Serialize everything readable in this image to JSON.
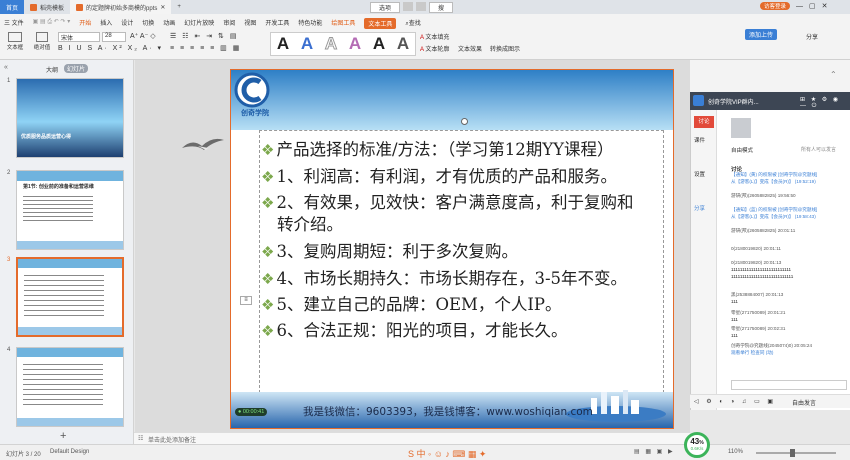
{
  "titlebar": {
    "tabs": [
      "首页",
      "稻壳模板",
      "的定题牌初始多商模的ppts"
    ],
    "center_btns": [
      "选项",
      "搜"
    ],
    "window": [
      "访客登录",
      "分享",
      "0"
    ],
    "cloud": "添加上传"
  },
  "menu": {
    "file": "三 文件",
    "items": [
      "开始",
      "插入",
      "设计",
      "切换",
      "动画",
      "幻灯片放映",
      "审阅",
      "视图",
      "开发工具",
      "特色功能"
    ],
    "drawing_tools": "绘图工具",
    "text_tools": "文本工具",
    "search": "查找"
  },
  "ribbon": {
    "font_name": "宋体",
    "font_size": "28",
    "textbox": "文本框",
    "style_label": "绝对值",
    "wordart_label": "A",
    "text_fill": "文本填充",
    "text_outline": "文本轮廓",
    "text_effect": "文本效果",
    "convert": "转换成图示"
  },
  "leftpane": {
    "tab_outline": "大纲",
    "tab_slides": "幻灯片",
    "slide_nums": [
      "1",
      "2",
      "3",
      "4"
    ],
    "slide1_title": "优质服务品质运营心得",
    "slide2_title": "第1节: 创业前的准备和运营思维",
    "add": "+"
  },
  "slide": {
    "logo_text": "创奇学院",
    "bullets": [
      "产品选择的标准/方法：（学习第12期YY课程）",
      "1、利润高：有利润，才有优质的产品和服务。",
      "2、有效果，见效快：客户满意度高，利于复购和",
      "转介绍。",
      "3、复购周期短：利于多次复购。",
      "4、市场长期持久：市场长期存在，3-5年不变。",
      "5、建立自己的品牌：OEM，个人IP。",
      "6、合法正规：阳光的项目，才能长久。"
    ],
    "footer": "我是钱微信：9603393，我是钱博客：www.woshiqian.com",
    "timer": "00:00:41"
  },
  "rpanel": {
    "title": "创奇学院VIP群内...",
    "side_tabs": [
      "讨论",
      "课件",
      "设置",
      "分享"
    ],
    "mode": "自由模式",
    "everyone": "所有人可以发言",
    "section": "讨论",
    "msgs": [
      "【通知】(黄) 的权限被 [创奇学院@究题线]",
      "从【游客(L)】变成【会员(R)】 (19:52:19)",
      "游研(邦)(2605882825) 19:56:50",
      "【通知】(蓝) 的权限被 [创奇学院@究题线]",
      "从【游客(L)】变成【会员(R)】 (19:58:43)",
      "游研(邦)(2605882825) 20:01:11",
      "0(2180019820) 20:01:11",
      "0(2180019820) 20:01:13",
      "111111111111111111111111111",
      "1111111111111111111111111111",
      "黑(2538884007) 20:01:13",
      "111",
      "零星(271750089) 20:01:21",
      "111",
      "零星(271750089) 20:02:31",
      "111",
      "创奇学院@究题线(2045074)0) 20:05:24",
      "观看举行 检查同 (动)"
    ],
    "input_bottom": "自由发言"
  },
  "notes": "单击此处添加备注",
  "status": {
    "slide": "幻灯片 3 / 20",
    "theme": "Default Design",
    "zoom": "110%",
    "net": "43",
    "net_unit": "%",
    "speed": "0.6K/s"
  },
  "colors": {
    "accent": "#e46b2b",
    "bullet": "#7ca84c",
    "slide_header": "#3a8bc8"
  }
}
